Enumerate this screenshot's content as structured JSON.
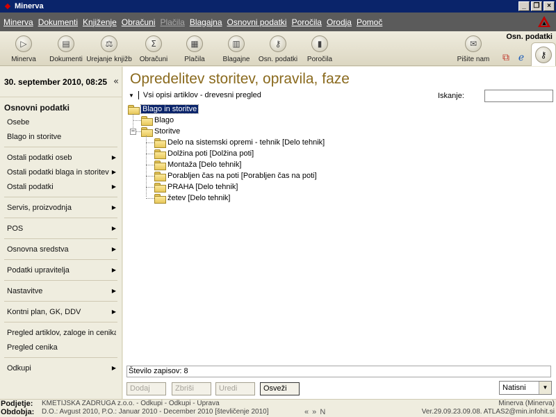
{
  "window": {
    "title": "Minerva"
  },
  "menubar": {
    "items": [
      {
        "label": "Minerva",
        "disabled": false
      },
      {
        "label": "Dokumenti",
        "disabled": false
      },
      {
        "label": "Knjiženje",
        "disabled": false
      },
      {
        "label": "Obračuni",
        "disabled": false
      },
      {
        "label": "Plačila",
        "disabled": true
      },
      {
        "label": "Blagajna",
        "disabled": false
      },
      {
        "label": "Osnovni podatki",
        "disabled": false
      },
      {
        "label": "Poročila",
        "disabled": false
      },
      {
        "label": "Orodja",
        "disabled": false
      },
      {
        "label": "Pomoč",
        "disabled": false
      }
    ]
  },
  "toolbar": {
    "tab_label": "Osn. podatki",
    "buttons": [
      {
        "label": "Minerva",
        "icon": "play-icon",
        "glyph": "▷"
      },
      {
        "label": "Dokumenti",
        "icon": "document-icon",
        "glyph": "▤"
      },
      {
        "label": "Urejanje knjižb",
        "icon": "ledger-icon",
        "glyph": "⚖"
      },
      {
        "label": "Obračuni",
        "icon": "calculation-icon",
        "glyph": "Σ"
      },
      {
        "label": "Plačila",
        "icon": "payment-icon",
        "glyph": "▦"
      },
      {
        "label": "Blagajne",
        "icon": "cash-register-icon",
        "glyph": "▥"
      },
      {
        "label": "Osn. podatki",
        "icon": "key-icon",
        "glyph": "⚷"
      },
      {
        "label": "Poročila",
        "icon": "report-chart-icon",
        "glyph": "▮"
      }
    ],
    "mail_button": {
      "label": "Pišite nam",
      "icon": "mail-icon",
      "glyph": "✉"
    }
  },
  "sidebar": {
    "date": "30. september 2010, 08:25",
    "section_title": "Osnovni podatki",
    "groups": [
      [
        {
          "label": "Osebe",
          "arrow": false
        },
        {
          "label": "Blago in storitve",
          "arrow": false
        }
      ],
      [
        {
          "label": "Ostali podatki oseb",
          "arrow": true
        },
        {
          "label": "Ostali podatki blaga in storitev",
          "arrow": true
        },
        {
          "label": "Ostali podatki",
          "arrow": true
        }
      ],
      [
        {
          "label": "Servis, proizvodnja",
          "arrow": true
        }
      ],
      [
        {
          "label": "POS",
          "arrow": true
        }
      ],
      [
        {
          "label": "Osnovna sredstva",
          "arrow": true
        }
      ],
      [
        {
          "label": "Podatki upravitelja",
          "arrow": true
        }
      ],
      [
        {
          "label": "Nastavitve",
          "arrow": true
        }
      ],
      [
        {
          "label": "Kontni plan, GK, DDV",
          "arrow": true
        }
      ],
      [
        {
          "label": "Pregled artiklov, zaloge in cenika",
          "arrow": false
        },
        {
          "label": "Pregled cenika",
          "arrow": false
        }
      ],
      [
        {
          "label": "Odkupi",
          "arrow": true
        }
      ]
    ]
  },
  "main": {
    "title": "Opredelitev storitev, opravila, faze",
    "filter_label": "Vsi opisi artiklov - drevesni pregled",
    "search_label": "Iskanje:",
    "search_value": "",
    "tree": {
      "root": "Blago in storitve",
      "children": [
        {
          "label": "Blago",
          "children": []
        },
        {
          "label": "Storitve",
          "children": [
            "Delo na sistemski opremi - tehnik [Delo tehnik]",
            "Dolžina poti [Dolžina poti]",
            "Montaža [Delo tehnik]",
            "Porabljen čas na poti [Porabljen čas na poti]",
            "PRAHA [Delo tehnik]",
            "žetev [Delo tehnik]"
          ]
        }
      ]
    },
    "record_count": "Število zapisov: 8",
    "actions": {
      "add": "Dodaj",
      "delete": "Zbriši",
      "edit": "Uredi",
      "refresh": "Osveži"
    },
    "print": {
      "value": "Natisni"
    }
  },
  "status": {
    "company_key": "Podjetje:",
    "company_value": "KMETIJSKA ZADRUGA z.o.o. - Odkupi - Odkupi - Uprava",
    "period_key": "Obdobja:",
    "period_value": "D.O.: Avgust 2010, P.O.: Januar 2010 - December 2010 [števličenje 2010]",
    "app_name": "Minerva (Minerva)",
    "version": "Ver.29.09.23.09.08. ATLAS2@min.infohit.si",
    "nav": "«   »   N"
  }
}
